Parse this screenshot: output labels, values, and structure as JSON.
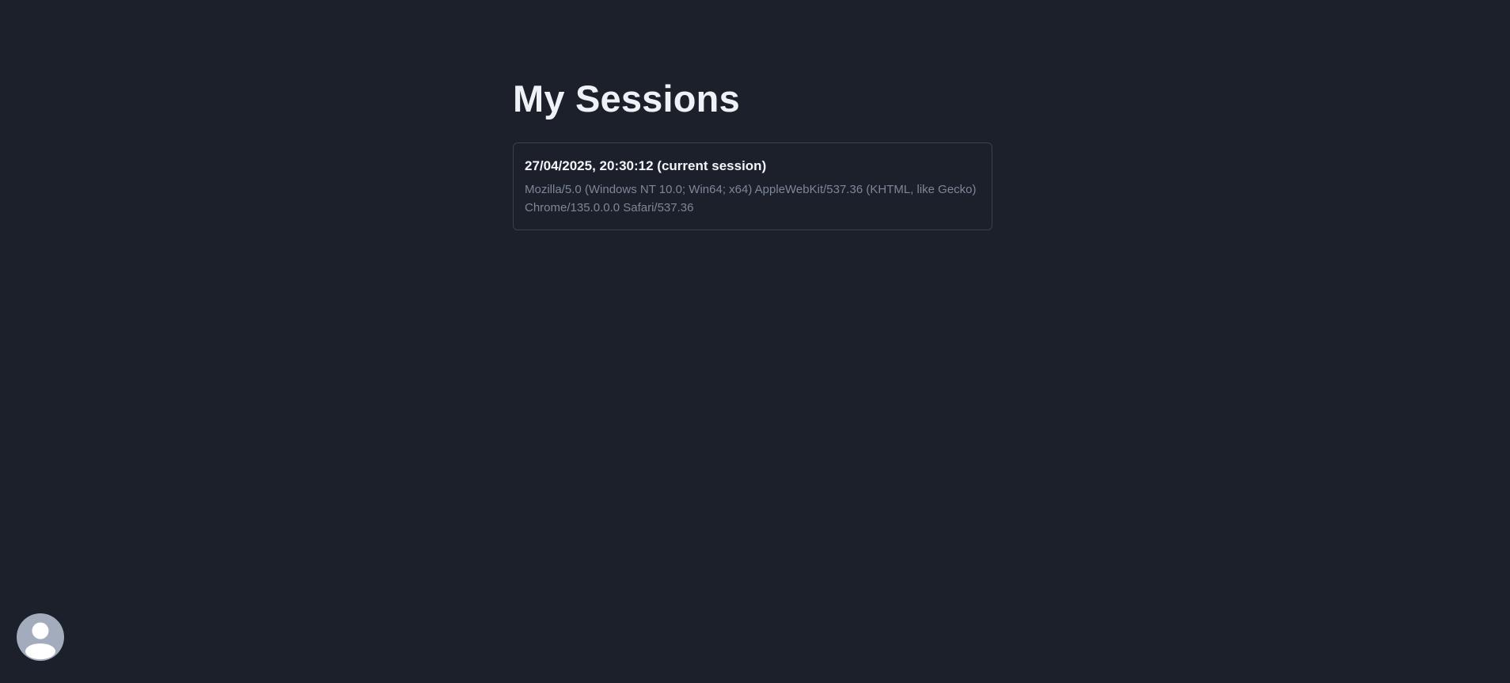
{
  "page": {
    "title": "My Sessions"
  },
  "sessions": [
    {
      "title": "27/04/2025, 20:30:12 (current session)",
      "user_agent": "Mozilla/5.0 (Windows NT 10.0; Win64; x64) AppleWebKit/537.36 (KHTML, like Gecko) Chrome/135.0.0.0 Safari/537.36"
    }
  ],
  "avatar": {
    "icon": "user-icon",
    "background": "#a2acbd"
  }
}
